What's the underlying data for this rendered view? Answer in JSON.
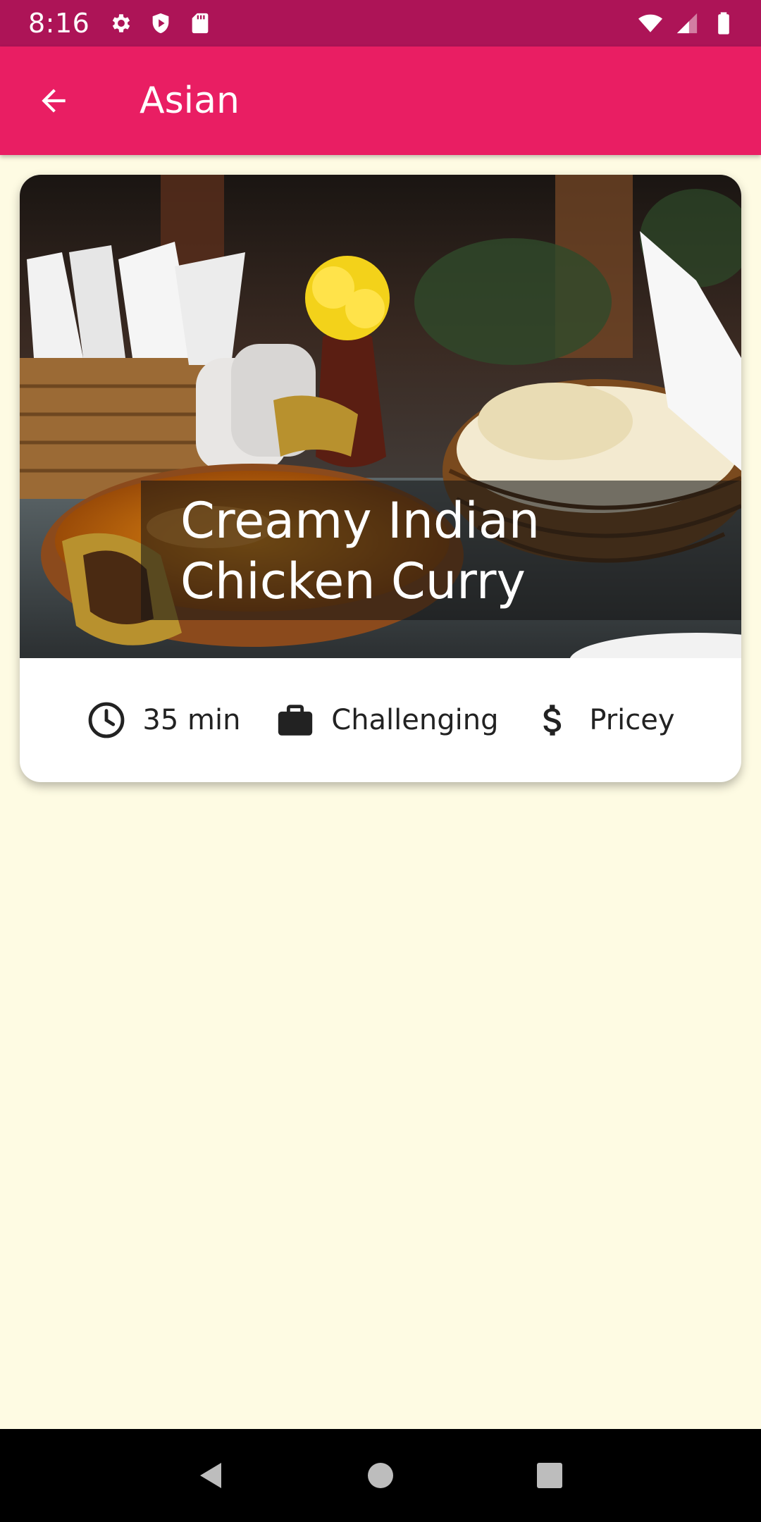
{
  "status_bar": {
    "time": "8:16",
    "icons_left": [
      "settings-icon",
      "shield-icon",
      "sd-card-icon"
    ],
    "icons_right": [
      "wifi-icon",
      "cellular-signal-icon",
      "battery-icon"
    ]
  },
  "app_bar": {
    "title": "Asian",
    "back_icon": "arrow-back-icon"
  },
  "recipe": {
    "title": "Creamy Indian Chicken Curry",
    "image_alt_subject": "curry-dish-with-naan-basket",
    "duration": "35 min",
    "complexity": "Challenging",
    "affordability": "Pricey",
    "duration_icon": "clock-icon",
    "complexity_icon": "briefcase-icon",
    "affordability_icon": "dollar-icon"
  },
  "colors": {
    "status_bar": "#ad1457",
    "app_bar": "#e91e63",
    "background": "#fefbe3",
    "card": "#ffffff"
  },
  "nav_bar": {
    "buttons": [
      "back-triangle-icon",
      "home-circle-icon",
      "recents-square-icon"
    ]
  }
}
